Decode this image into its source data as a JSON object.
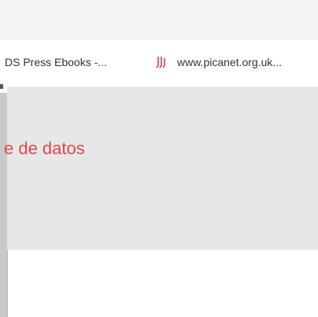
{
  "bookmarks": [
    {
      "label": "DS Press Ebooks -...",
      "icon": "none"
    },
    {
      "label": "www.picanet.org.uk...",
      "icon": "picanet-logo-icon",
      "icon_color": "#d04040"
    }
  ],
  "page": {
    "heading": "e de datos",
    "heading_color": "#e0474c",
    "content_background": "#e6e7e8"
  }
}
